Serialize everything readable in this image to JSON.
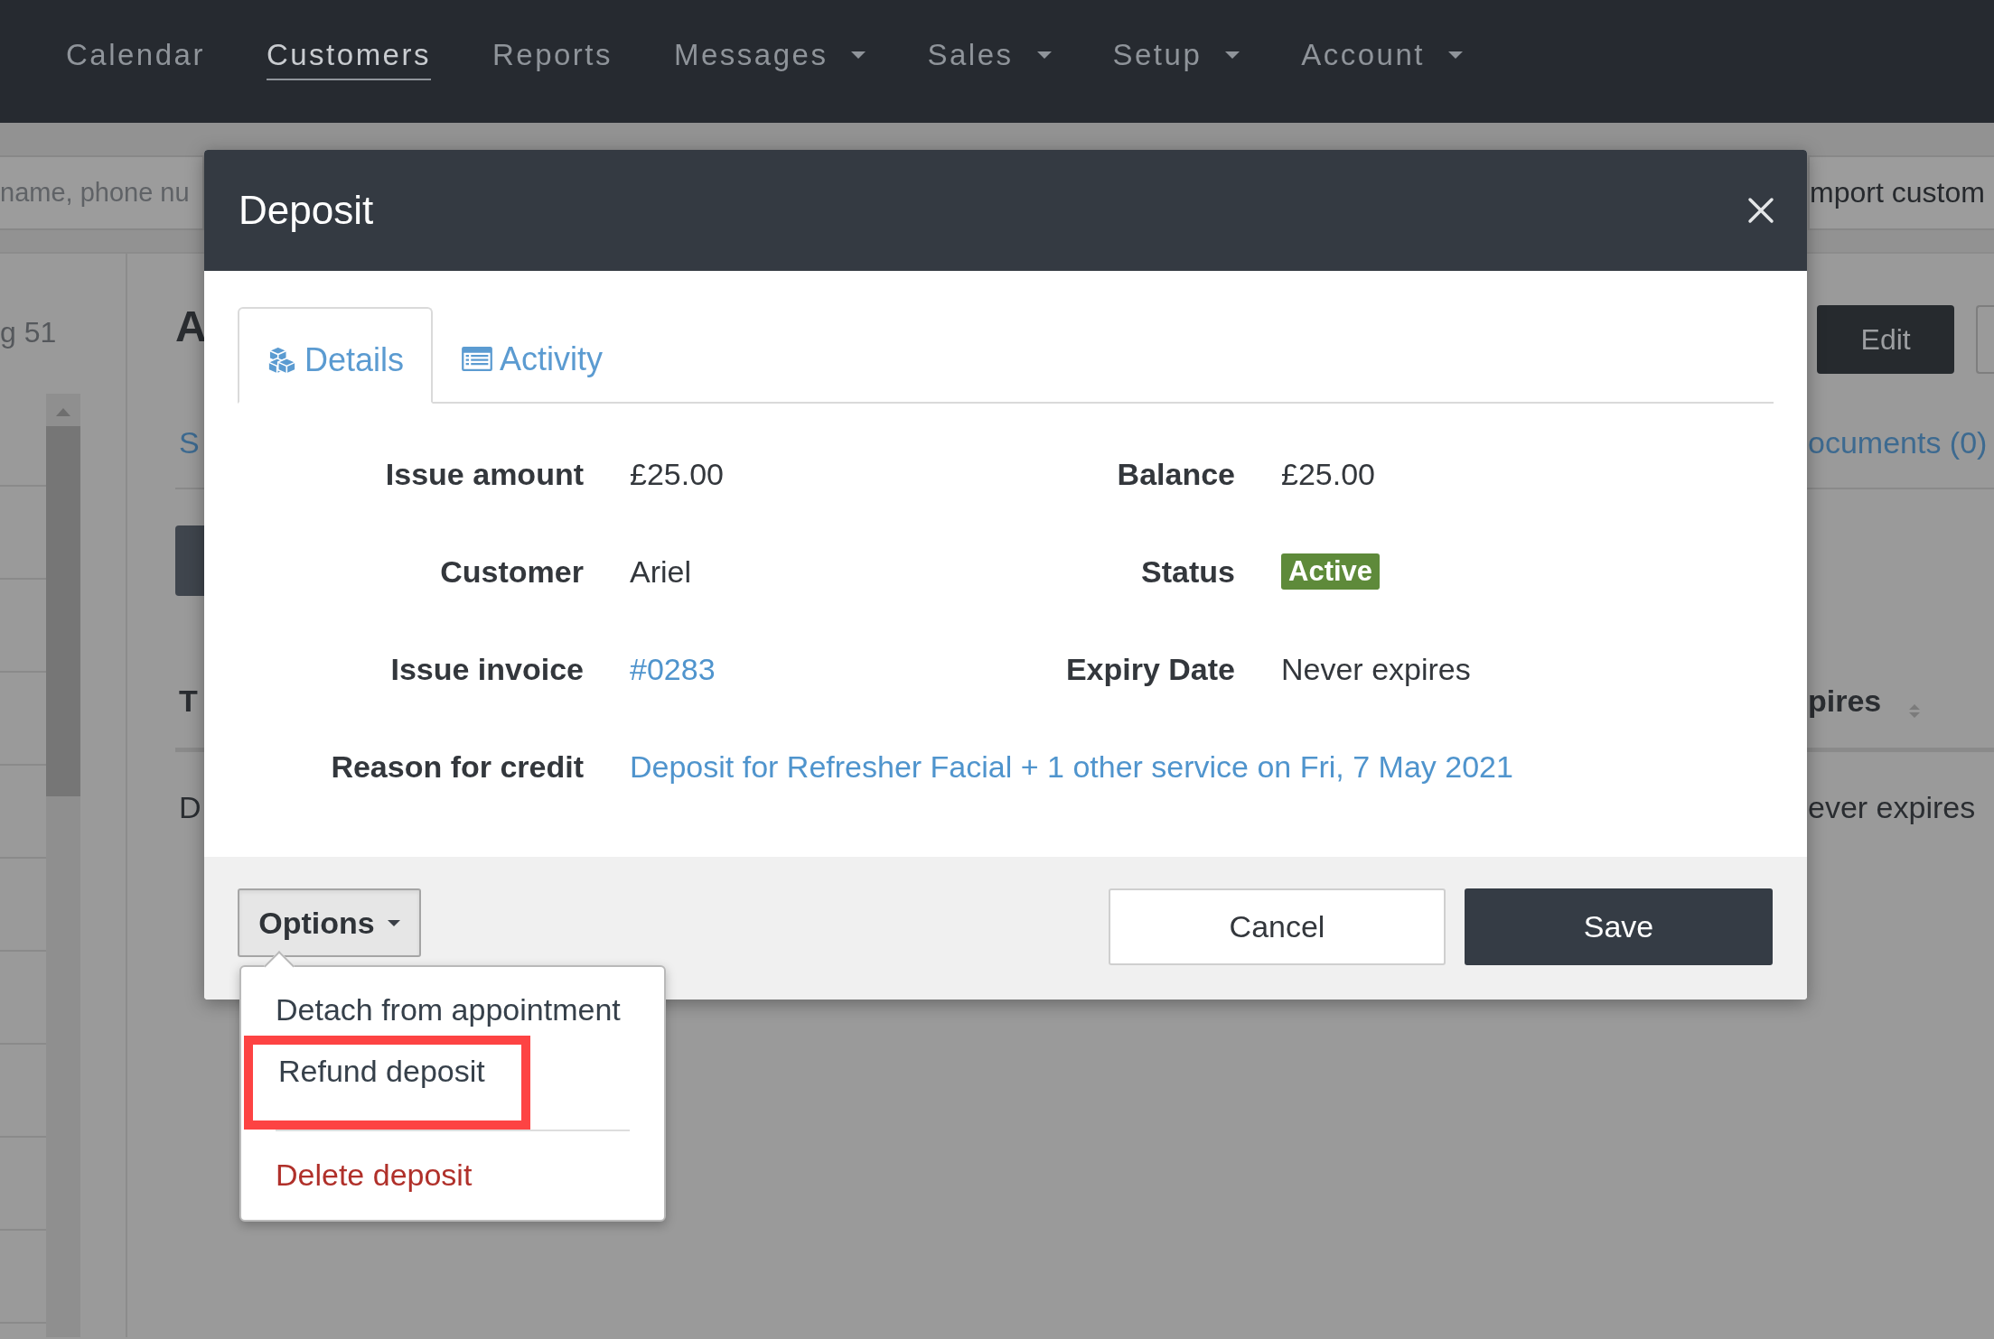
{
  "nav": {
    "items": [
      {
        "label": "Calendar",
        "selected": false,
        "dropdown": false
      },
      {
        "label": "Customers",
        "selected": true,
        "dropdown": false
      },
      {
        "label": "Reports",
        "selected": false,
        "dropdown": false
      },
      {
        "label": "Messages",
        "selected": false,
        "dropdown": true
      },
      {
        "label": "Sales",
        "selected": false,
        "dropdown": true
      },
      {
        "label": "Setup",
        "selected": false,
        "dropdown": true
      },
      {
        "label": "Account",
        "selected": false,
        "dropdown": true
      }
    ]
  },
  "background": {
    "search_field": {
      "placeholder": "name, phone nu"
    },
    "import_button": "mport custom",
    "count_text": "g 51",
    "heading": "A",
    "tab_link": "S",
    "documents_link": "ocuments (0)",
    "edit_button": "Edit",
    "table": {
      "columns": [
        "T",
        "pires"
      ],
      "rows": [
        [
          "D",
          "ever expires"
        ]
      ]
    }
  },
  "dialog": {
    "title": "Deposit",
    "tabs": [
      {
        "label": "Details",
        "selected": true
      },
      {
        "label": "Activity",
        "selected": false
      }
    ],
    "rows": [
      [
        {
          "label": "Issue amount",
          "value": "£25.00",
          "kind": "text"
        },
        {
          "label": "Balance",
          "value": "£25.00",
          "kind": "text"
        }
      ],
      [
        {
          "label": "Customer",
          "value": "Ariel",
          "kind": "text"
        },
        {
          "label": "Status",
          "value": "Active",
          "kind": "badge"
        }
      ],
      [
        {
          "label": "Issue invoice",
          "value": "#0283",
          "kind": "link"
        },
        {
          "label": "Expiry Date",
          "value": "Never expires",
          "kind": "text"
        }
      ],
      [
        {
          "label": "Reason for credit",
          "value": "Deposit for Refresher Facial + 1 other service on Fri, 7 May 2021",
          "kind": "link"
        }
      ]
    ],
    "options_button": "Options",
    "menu": {
      "items": [
        {
          "label": "Detach from appointment",
          "kind": "normal",
          "highlighted": false
        },
        {
          "label": "Refund deposit",
          "kind": "normal",
          "highlighted": true
        },
        {
          "label": "Delete deposit",
          "kind": "danger",
          "highlighted": false
        }
      ]
    },
    "buttons": [
      {
        "label": "Cancel",
        "kind": "secondary"
      },
      {
        "label": "Save",
        "kind": "primary"
      }
    ]
  }
}
